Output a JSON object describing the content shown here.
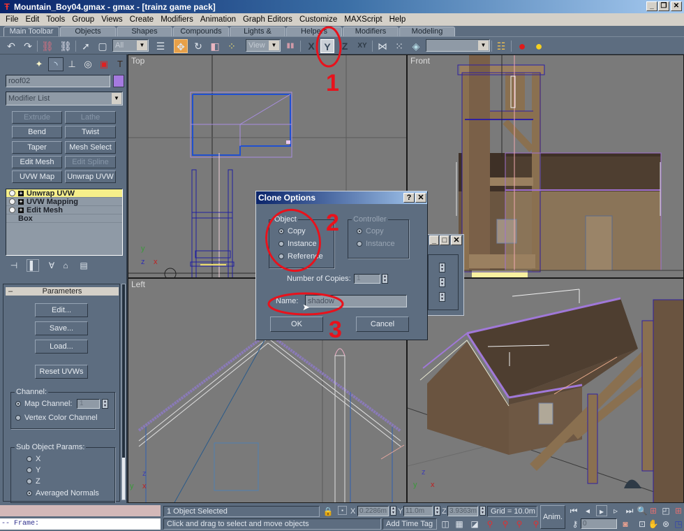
{
  "window": {
    "title": "Mountain_Boy04.gmax - gmax - [trainz game pack]",
    "app_icon": "gmax-logo-icon",
    "controls": {
      "minimize": "_",
      "restore": "❐",
      "close": "✕"
    }
  },
  "menubar": [
    "File",
    "Edit",
    "Tools",
    "Group",
    "Views",
    "Create",
    "Modifiers",
    "Animation",
    "Graph Editors",
    "Customize",
    "MAXScript",
    "Help"
  ],
  "tabs": [
    {
      "label": "Main Toolbar",
      "active": true
    },
    {
      "label": "Objects"
    },
    {
      "label": "Shapes"
    },
    {
      "label": "Compounds"
    },
    {
      "label": "Lights & Cameras"
    },
    {
      "label": "Helpers"
    },
    {
      "label": "Modifiers"
    },
    {
      "label": "Modeling"
    }
  ],
  "toolbar": {
    "selection_filter": "All",
    "reference_coord": "View",
    "named_selection": "",
    "buttons": [
      {
        "name": "undo-icon",
        "glyph": "↶"
      },
      {
        "name": "redo-icon",
        "glyph": "↷"
      },
      {
        "name": "select-and-link-icon",
        "glyph": "⛓"
      },
      {
        "name": "unlink-icon",
        "glyph": "⛓"
      },
      {
        "name": "select-object-icon",
        "glyph": "➚"
      },
      {
        "name": "region-select-icon",
        "glyph": "▢"
      },
      {
        "name": "select-by-name-icon",
        "glyph": "☰"
      },
      {
        "name": "select-and-move-icon",
        "glyph": "✥",
        "active": true
      },
      {
        "name": "select-and-rotate-icon",
        "glyph": "↻"
      },
      {
        "name": "select-and-scale-icon",
        "glyph": "◧"
      },
      {
        "name": "use-pivot-center-icon",
        "glyph": "⁘"
      },
      {
        "name": "align-view-icon",
        "glyph": "▮▮"
      },
      {
        "name": "restrict-x-icon",
        "glyph": "X"
      },
      {
        "name": "restrict-y-icon",
        "glyph": "Y",
        "pressed": true
      },
      {
        "name": "restrict-z-icon",
        "glyph": "Z"
      },
      {
        "name": "restrict-xy-icon",
        "glyph": "XY"
      },
      {
        "name": "mirror-icon",
        "glyph": "⋈"
      },
      {
        "name": "array-icon",
        "glyph": "⁙"
      },
      {
        "name": "align-icon",
        "glyph": "◈"
      },
      {
        "name": "layers-icon",
        "glyph": "☷"
      },
      {
        "name": "material-editor-icon",
        "glyph": "●"
      },
      {
        "name": "render-icon",
        "glyph": "●"
      }
    ]
  },
  "command_panel": {
    "tabs": [
      "create-icon",
      "modify-icon",
      "hierarchy-icon",
      "motion-icon",
      "display-icon",
      "utilities-icon"
    ],
    "object_name": "roof02",
    "object_color": "#a57ae0",
    "modifier_list": "Modifier List",
    "modifier_buttons": [
      {
        "label": "Extrude",
        "disabled": true
      },
      {
        "label": "Lathe",
        "disabled": true
      },
      {
        "label": "Bend"
      },
      {
        "label": "Twist"
      },
      {
        "label": "Taper"
      },
      {
        "label": "Mesh Select"
      },
      {
        "label": "Edit Mesh"
      },
      {
        "label": "Edit Spline",
        "disabled": true
      },
      {
        "label": "UVW Map"
      },
      {
        "label": "Unwrap UVW"
      }
    ],
    "stack": [
      {
        "label": "Unwrap UVW",
        "selected": true,
        "expandable": true
      },
      {
        "label": "UVW Mapping",
        "expandable": true
      },
      {
        "label": "Edit Mesh",
        "expandable": true
      },
      {
        "label": "Box"
      }
    ],
    "stack_tools": [
      "pin-stack-icon",
      "show-end-result-icon",
      "make-unique-icon",
      "remove-modifier-icon",
      "configure-modifier-sets-icon"
    ]
  },
  "parameters": {
    "title": "Parameters",
    "collapse": "–",
    "buttons": [
      "Edit...",
      "Save...",
      "Load...",
      "Reset UVWs"
    ],
    "channel": {
      "label": "Channel:",
      "map_channel": "Map Channel:",
      "map_channel_value": "1",
      "vertex_color": "Vertex Color Channel",
      "selected": "map"
    },
    "sub_object": {
      "label": "Sub Object Params:",
      "options": [
        "X",
        "Y",
        "Z",
        "Averaged Normals"
      ],
      "selected": "Averaged Normals"
    }
  },
  "viewports": {
    "top": "Top",
    "front": "Front",
    "left": "Left",
    "perspective": ""
  },
  "clone_dialog": {
    "title": "Clone Options",
    "help": "?",
    "close": "✕",
    "object_group": "Object",
    "object_options": [
      "Copy",
      "Instance",
      "Reference"
    ],
    "object_selected": "Copy",
    "controller_group": "Controller",
    "controller_options": [
      "Copy",
      "Instance"
    ],
    "controller_selected": "Copy",
    "copies_label": "Number of Copies:",
    "copies_value": "1",
    "name_label": "Name:",
    "name_value": "shadow",
    "ok": "OK",
    "cancel": "Cancel"
  },
  "annotations": [
    "1",
    "2",
    "3"
  ],
  "status": {
    "listener_output": "",
    "listener_input": "-- Frame:",
    "selection": "1 Object Selected",
    "prompt": "Click and drag to select and move objects",
    "x_label": "X",
    "x_value": "0.2286m",
    "y_label": "Y",
    "y_value": "11.0m",
    "z_label": "Z",
    "z_value": "3.9363m",
    "grid": "Grid = 10.0m",
    "add_time_tag": "Add Time Tag",
    "anim": "Anim.",
    "frame": "0"
  }
}
